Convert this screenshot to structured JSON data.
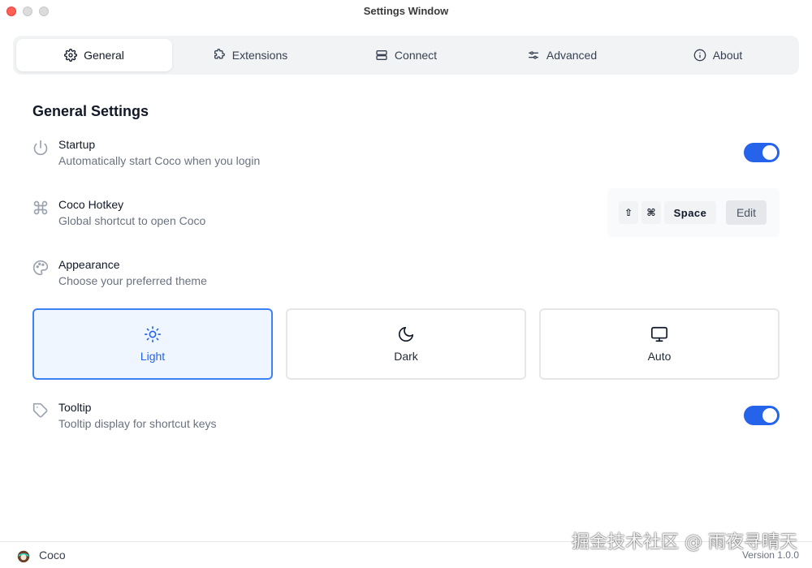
{
  "window": {
    "title": "Settings Window"
  },
  "tabs": [
    {
      "label": "General",
      "icon": "gear-icon",
      "active": true
    },
    {
      "label": "Extensions",
      "icon": "puzzle-icon",
      "active": false
    },
    {
      "label": "Connect",
      "icon": "server-icon",
      "active": false
    },
    {
      "label": "Advanced",
      "icon": "sliders-icon",
      "active": false
    },
    {
      "label": "About",
      "icon": "info-icon",
      "active": false
    }
  ],
  "section": {
    "title": "General Settings"
  },
  "settings": {
    "startup": {
      "title": "Startup",
      "description": "Automatically start Coco when you login",
      "icon": "power-icon",
      "enabled": true
    },
    "hotkey": {
      "title": "Coco Hotkey",
      "description": "Global shortcut to open Coco",
      "icon": "command-icon",
      "keys": [
        "⇧",
        "⌘",
        "Space"
      ],
      "edit_label": "Edit"
    },
    "appearance": {
      "title": "Appearance",
      "description": "Choose your preferred theme",
      "icon": "palette-icon"
    },
    "tooltip": {
      "title": "Tooltip",
      "description": "Tooltip display for shortcut keys",
      "icon": "tag-icon",
      "enabled": true
    }
  },
  "themes": [
    {
      "label": "Light",
      "icon": "sun-icon",
      "selected": true
    },
    {
      "label": "Dark",
      "icon": "moon-icon",
      "selected": false
    },
    {
      "label": "Auto",
      "icon": "monitor-icon",
      "selected": false
    }
  ],
  "footer": {
    "app_name": "Coco",
    "version": "Version 1.0.0"
  },
  "watermark": "掘金技术社区 @ 雨夜寻晴天",
  "colors": {
    "accent": "#2563eb",
    "selected_border": "#3b82f6",
    "selected_bg": "#eff6ff",
    "close_button": "#ff5f57"
  }
}
